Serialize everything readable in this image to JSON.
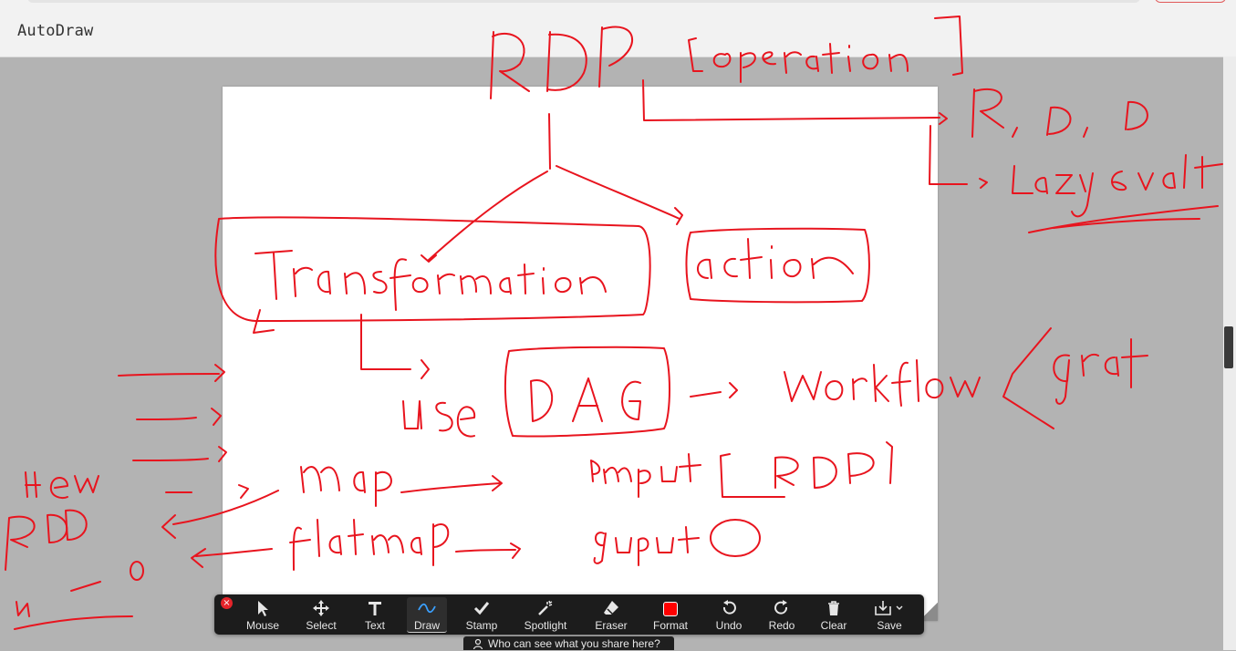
{
  "app": {
    "title": "AutoDraw"
  },
  "toolbar": {
    "tools": [
      {
        "id": "mouse",
        "label": "Mouse",
        "icon": "arrow-cursor-icon",
        "active": false
      },
      {
        "id": "select",
        "label": "Select",
        "icon": "move-arrows-icon",
        "active": false
      },
      {
        "id": "text",
        "label": "Text",
        "icon": "text-T-icon",
        "active": false
      },
      {
        "id": "draw",
        "label": "Draw",
        "icon": "pen-squiggle-icon",
        "active": true
      },
      {
        "id": "stamp",
        "label": "Stamp",
        "icon": "checkmark-icon",
        "active": false
      },
      {
        "id": "spotlight",
        "label": "Spotlight",
        "icon": "magic-wand-icon",
        "active": false
      },
      {
        "id": "eraser",
        "label": "Eraser",
        "icon": "eraser-icon",
        "active": false
      },
      {
        "id": "format",
        "label": "Format",
        "icon": "color-swatch-icon",
        "active": false
      },
      {
        "id": "undo",
        "label": "Undo",
        "icon": "undo-icon",
        "active": false
      },
      {
        "id": "redo",
        "label": "Redo",
        "icon": "redo-icon",
        "active": false
      },
      {
        "id": "clear",
        "label": "Clear",
        "icon": "trash-icon",
        "active": false
      },
      {
        "id": "save",
        "label": "Save",
        "icon": "save-download-icon",
        "active": false
      }
    ],
    "format_color": "#ff0000"
  },
  "share_tip": {
    "text": "Who can see what you share here?"
  },
  "colors": {
    "ink": "#e8141e",
    "toolbar_bg": "#1c1c1c",
    "canvas": "#ffffff",
    "backdrop": "#b3b3b3"
  }
}
